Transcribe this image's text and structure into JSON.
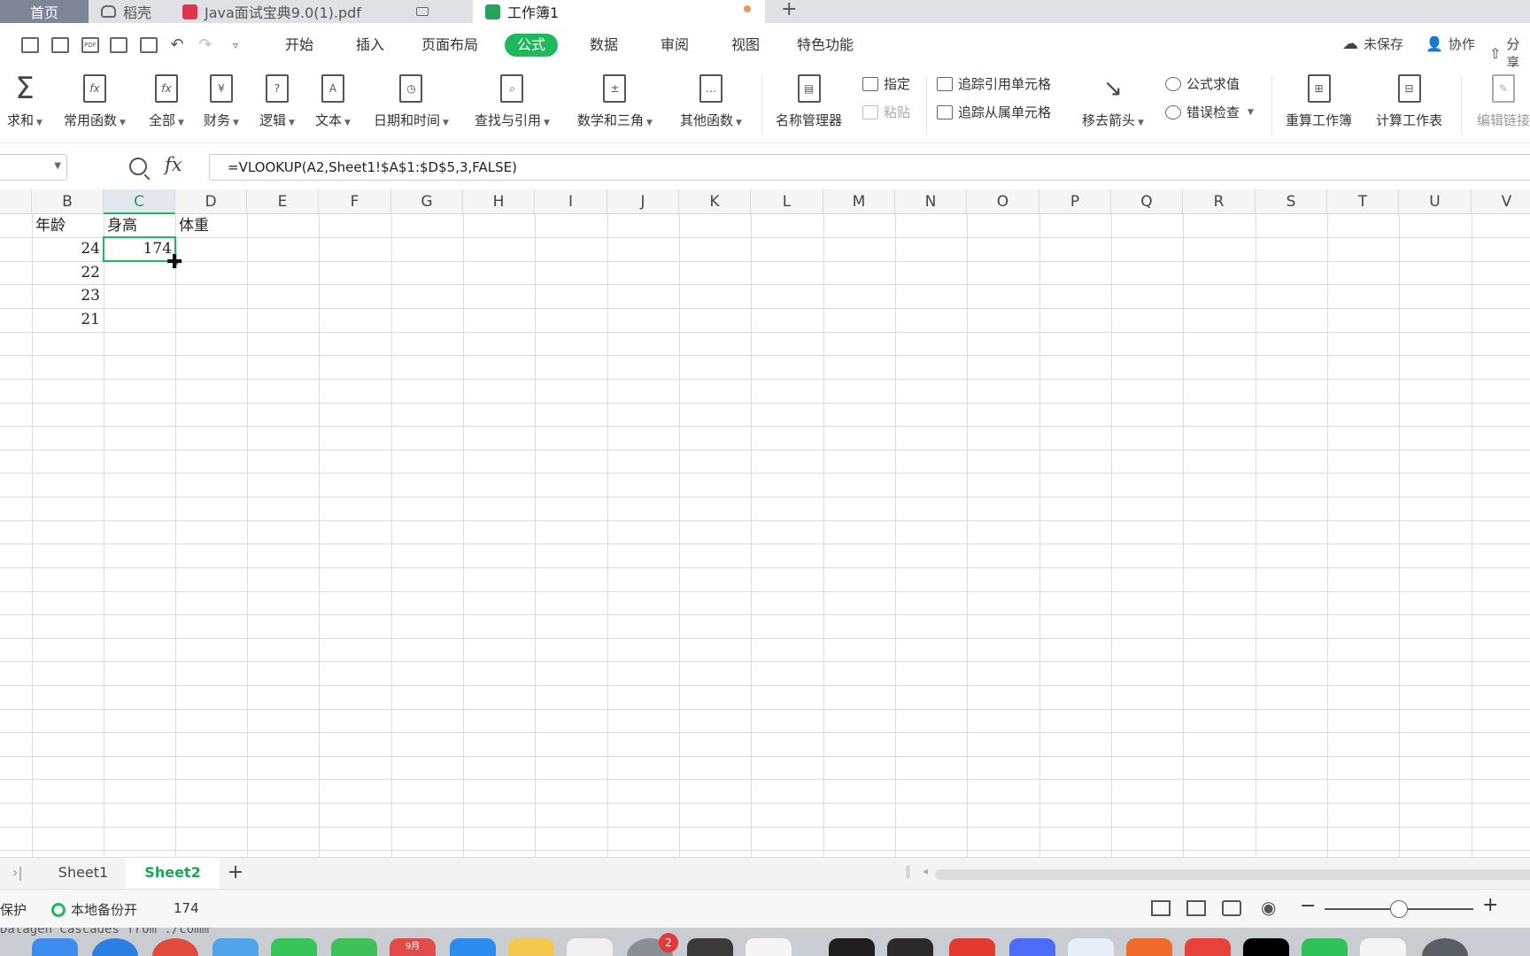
{
  "tabs": {
    "home": "首页",
    "shell": "稻壳",
    "pdf": "Java面试宝典9.0(1).pdf",
    "workbook": "工作簿1",
    "new_tab": "+"
  },
  "menu": {
    "items": [
      "开始",
      "插入",
      "页面布局",
      "公式",
      "数据",
      "审阅",
      "视图",
      "特色功能"
    ],
    "unsaved": "未保存",
    "collab": "协作",
    "share": "分享"
  },
  "ribbon": {
    "sum": "求和",
    "common": "常用函数",
    "all": "全部",
    "finance": "财务",
    "logic": "逻辑",
    "text": "文本",
    "datetime": "日期和时间",
    "lookup": "查找与引用",
    "math": "数学和三角",
    "other": "其他函数",
    "name_mgr": "名称管理器",
    "assign": "指定",
    "paste": "粘贴",
    "trace_prec": "追踪引用单元格",
    "trace_dep": "追踪从属单元格",
    "remove_arrows": "移去箭头",
    "eval": "公式求值",
    "error_check": "错误检查",
    "recalc_book": "重算工作簿",
    "calc_sheet": "计算工作表",
    "edit_links": "编辑链接"
  },
  "formula_bar": {
    "fx": "fx",
    "formula": "=VLOOKUP(A2,Sheet1!$A$1:$D$5,3,FALSE)"
  },
  "columns": [
    "B",
    "C",
    "D",
    "E",
    "F",
    "G",
    "H",
    "I",
    "J",
    "K",
    "L",
    "M",
    "N",
    "O",
    "P",
    "Q",
    "R",
    "S",
    "T",
    "U",
    "V"
  ],
  "cells": {
    "b1": "年龄",
    "c1": "身高",
    "d1": "体重",
    "b2": "24",
    "c2": "174",
    "b3": "22",
    "b4": "23",
    "b5": "21"
  },
  "sheets": {
    "sheet1": "Sheet1",
    "sheet2": "Sheet2",
    "add": "+"
  },
  "status": {
    "protect": "保护",
    "backup": "本地备份开",
    "value": "174"
  },
  "dock": {
    "calendar_label": "9月",
    "badge": "2",
    "terminal_text": "Datagen Cascades from ./comm"
  }
}
